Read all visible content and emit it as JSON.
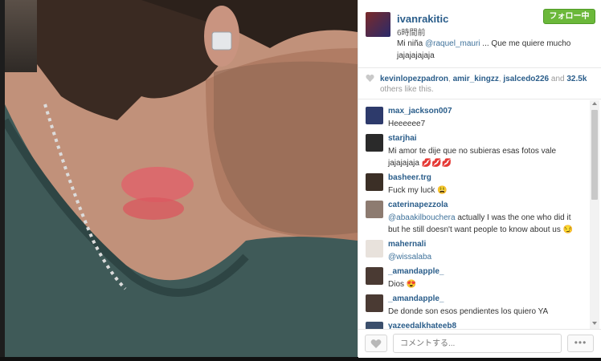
{
  "post": {
    "author": "ivanrakitic",
    "time": "6時間前",
    "caption_prefix": "Mi niña ",
    "caption_mention": "@raquel_mauri",
    "caption_suffix": " ... Que me quiere mucho jajajajajaja",
    "follow_label": "フォロー中"
  },
  "likes": {
    "user1": "kevinlopezpadron",
    "sep1": ", ",
    "user2": "amir_kingzz",
    "sep2": ", ",
    "user3": "jsalcedo226",
    "and": " and ",
    "count": "32.5k",
    "suffix": " others like this."
  },
  "comments": [
    {
      "user": "max_jackson007",
      "text": "Heeeeee7"
    },
    {
      "user": "starjhai",
      "text": "Mi amor te dije que no subieras esas fotos vale jajajajaja 💋💋💋"
    },
    {
      "user": "basheer.trg",
      "text": "Fuck my luck 😩"
    },
    {
      "user": "caterinapezzola",
      "mention": "@abaakilbouchera",
      "text": " actually I was the one who did it but he still doesn't want people to know about us 😏"
    },
    {
      "user": "mahernali",
      "mention": "@wissalaba",
      "text": ""
    },
    {
      "user": "_amandapple_",
      "text": "Dios 😍"
    },
    {
      "user": "_amandapple_",
      "text": "De donde son esos pendientes los quiero YA"
    },
    {
      "user": "yazeedalkhateeb8",
      "text": ""
    }
  ],
  "footer": {
    "comment_placeholder": "コメントする...",
    "more_label": "•••"
  },
  "colors": {
    "link": "#2a5d8a",
    "follow_green": "#6bb83a"
  },
  "icons": {
    "like": "heart-icon",
    "more": "ellipsis-icon"
  }
}
